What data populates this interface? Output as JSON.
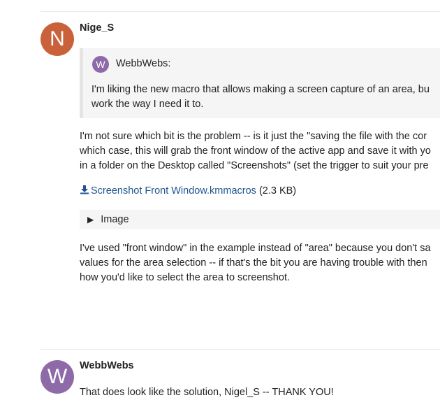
{
  "post1": {
    "avatar_letter": "N",
    "avatar_color": "#c9623a",
    "username": "Nige_S",
    "quote": {
      "avatar_letter": "W",
      "avatar_color": "#8e6aa8",
      "author": "WebbWebs:",
      "lines": [
        "I'm liking the new macro that allows making a screen capture of an area, bu",
        "work the way I need it to."
      ]
    },
    "paragraph1": [
      "I'm not sure which bit is the problem -- is it just the \"saving the file with the cor",
      "which case, this will grab the front window of the active app and save it with yo",
      "in a folder on the Desktop called \"Screenshots\" (set the trigger to suit your pre"
    ],
    "attachment": {
      "icon": "download-icon",
      "name": "Screenshot Front Window.kmmacros",
      "size": "(2.3 KB)"
    },
    "details_label": "Image",
    "details_icon": "triangle-right-icon",
    "paragraph2": [
      "I've used \"front window\" in the example instead of \"area\" because you don't sa",
      "values for the area selection -- if that's the bit you are having trouble with then",
      "how you'd like to select the area to screenshot."
    ]
  },
  "post2": {
    "avatar_letter": "W",
    "avatar_color": "#8e6aa8",
    "username": "WebbWebs",
    "text": "That does look like the solution, Nigel_S -- THANK YOU!"
  },
  "colors": {
    "link": "#1f5490",
    "quote_bg": "#f5f5f5",
    "divider": "#e9e9e9"
  }
}
